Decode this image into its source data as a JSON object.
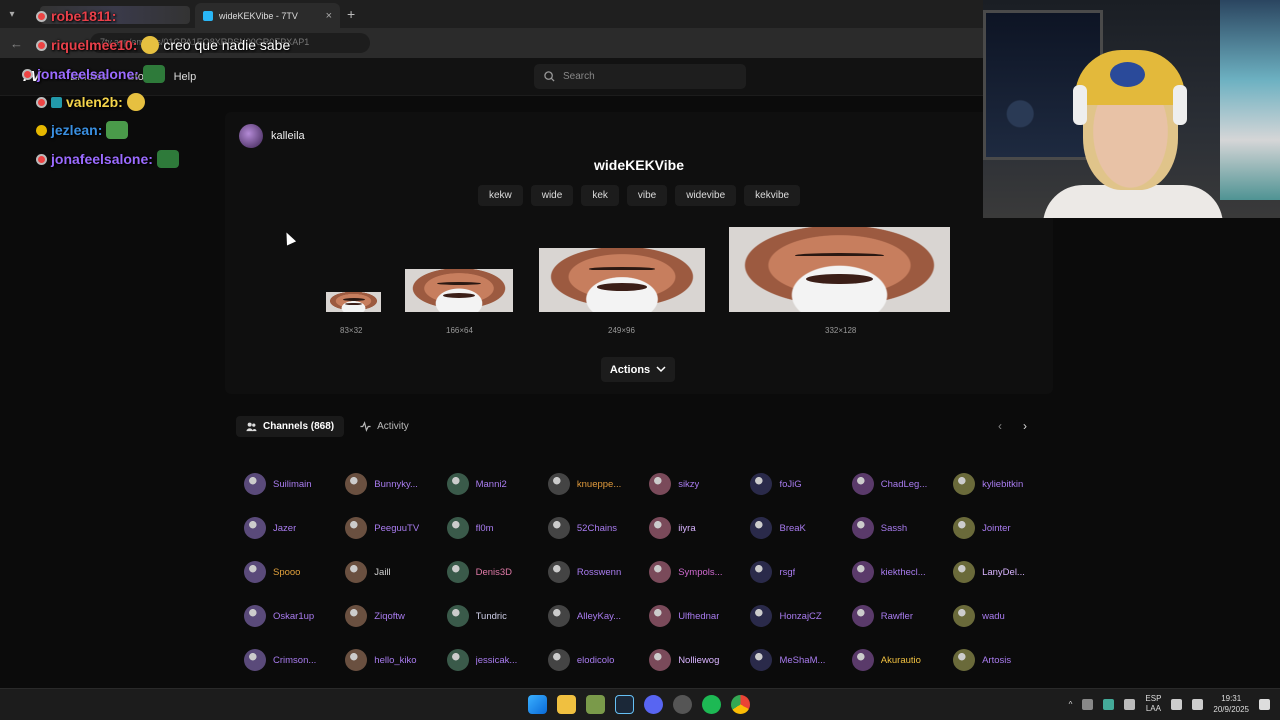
{
  "browser": {
    "tab_title": "wideKEKVibe - 7TV",
    "address_text": "7tv.app/emotes/01GPA1EQ8XRPSN00GR0EPXAP1"
  },
  "site": {
    "logo": "7V",
    "nav": [
      "Emotes",
      "Store",
      "Help"
    ],
    "search_placeholder": "Search"
  },
  "overlay_chat": [
    {
      "user": "robe1811:",
      "color": "#e8404a",
      "msg": ""
    },
    {
      "user": "riquelmee10:",
      "color": "#e8404a",
      "msg": "creo que nadie sabe"
    },
    {
      "user": "jonafeelsalone:",
      "color": "#9b6bff",
      "msg": ""
    },
    {
      "user": "valen2b:",
      "color": "#f4d44a",
      "msg": ""
    },
    {
      "user": "jezlean:",
      "color": "#3a8fe0",
      "msg": ""
    },
    {
      "user": "jonafeelsalone:",
      "color": "#9b6bff",
      "msg": ""
    }
  ],
  "emote": {
    "author": "kalleila",
    "name": "wideKEKVibe",
    "tags": [
      "kekw",
      "wide",
      "kek",
      "vibe",
      "widevibe",
      "kekvibe"
    ],
    "sizes": [
      "83×32",
      "166×64",
      "249×96",
      "332×128"
    ],
    "actions_label": "Actions"
  },
  "channels_section": {
    "tab_channels": "Channels (868)",
    "tab_activity": "Activity",
    "channels": [
      {
        "name": "Suilimain",
        "color": "#a97cf0"
      },
      {
        "name": "Bunnyky...",
        "color": "#a97cf0"
      },
      {
        "name": "Manni2",
        "color": "#a97cf0"
      },
      {
        "name": "knueppe...",
        "color": "#e09a3c"
      },
      {
        "name": "sikzy",
        "color": "#a97cf0"
      },
      {
        "name": "foJiG",
        "color": "#a97cf0"
      },
      {
        "name": "ChadLeg...",
        "color": "#a97cf0"
      },
      {
        "name": "kyliebitkin",
        "color": "#a97cf0"
      },
      {
        "name": "Jazer",
        "color": "#a97cf0"
      },
      {
        "name": "PeeguuTV",
        "color": "#a97cf0"
      },
      {
        "name": "fl0m",
        "color": "#a97cf0"
      },
      {
        "name": "52Chains",
        "color": "#a97cf0"
      },
      {
        "name": "iiyra",
        "color": "#d9b4ff"
      },
      {
        "name": "BreaK",
        "color": "#a97cf0"
      },
      {
        "name": "Sassh",
        "color": "#a97cf0"
      },
      {
        "name": "Jointer",
        "color": "#a97cf0"
      },
      {
        "name": "Spooo",
        "color": "#e0a03c"
      },
      {
        "name": "Jaill",
        "color": "#cfcfcf"
      },
      {
        "name": "Denis3D",
        "color": "#e07aa8"
      },
      {
        "name": "Rosswenn",
        "color": "#a97cf0"
      },
      {
        "name": "Sympols...",
        "color": "#d06ad0"
      },
      {
        "name": "rsgf",
        "color": "#a97cf0"
      },
      {
        "name": "kiekthecl...",
        "color": "#a97cf0"
      },
      {
        "name": "LanyDel...",
        "color": "#d9b4ff"
      },
      {
        "name": "Oskar1up",
        "color": "#a97cf0"
      },
      {
        "name": "Ziqoftw",
        "color": "#a97cf0"
      },
      {
        "name": "Tundric",
        "color": "#cfcfe8"
      },
      {
        "name": "AlleyKay...",
        "color": "#a97cf0"
      },
      {
        "name": "Ulfhednar",
        "color": "#a97cf0"
      },
      {
        "name": "HonzajCZ",
        "color": "#a97cf0"
      },
      {
        "name": "Rawfler",
        "color": "#a97cf0"
      },
      {
        "name": "wadu",
        "color": "#a97cf0"
      },
      {
        "name": "Crimson...",
        "color": "#a97cf0"
      },
      {
        "name": "hello_kiko",
        "color": "#a97cf0"
      },
      {
        "name": "jessicak...",
        "color": "#a97cf0"
      },
      {
        "name": "elodicolo",
        "color": "#a97cf0"
      },
      {
        "name": "Nolliewog",
        "color": "#d9b4ff"
      },
      {
        "name": "MeShaM...",
        "color": "#a97cf0"
      },
      {
        "name": "Akurautio",
        "color": "#f0c040"
      },
      {
        "name": "Artosis",
        "color": "#a97cf0"
      }
    ]
  },
  "taskbar": {
    "lang_top": "ESP",
    "lang_bottom": "LAA",
    "time": "19:31",
    "date": "20/9/2025"
  },
  "colors": {
    "accent": "#a97cf0",
    "bg": "#0b0b0b"
  }
}
